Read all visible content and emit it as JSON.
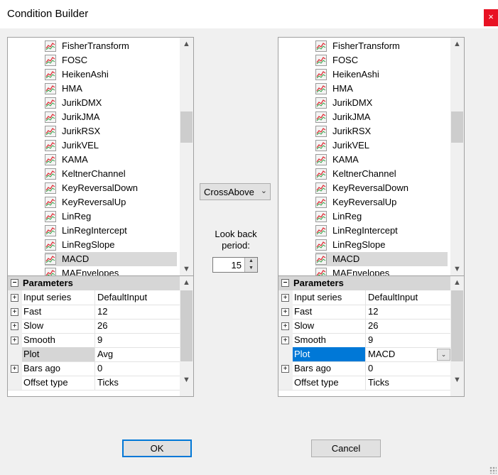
{
  "window": {
    "title": "Condition Builder",
    "close_glyph": "×"
  },
  "indicators": [
    "FisherTransform",
    "FOSC",
    "HeikenAshi",
    "HMA",
    "JurikDMX",
    "JurikJMA",
    "JurikRSX",
    "JurikVEL",
    "KAMA",
    "KeltnerChannel",
    "KeyReversalDown",
    "KeyReversalUp",
    "LinReg",
    "LinRegIntercept",
    "LinRegSlope",
    "MACD",
    "MAEnvelopes"
  ],
  "left_list": {
    "selected": "MACD"
  },
  "right_list": {
    "selected": "MACD"
  },
  "condition": {
    "operator": "CrossAbove",
    "lookback_label": "Look back period:",
    "lookback_value": "15"
  },
  "left_params": {
    "header": "Parameters",
    "rows": [
      {
        "name": "Input series",
        "value": "DefaultInput",
        "expander": true
      },
      {
        "name": "Fast",
        "value": "12",
        "expander": true
      },
      {
        "name": "Slow",
        "value": "26",
        "expander": true
      },
      {
        "name": "Smooth",
        "value": "9",
        "expander": true
      },
      {
        "name": "Plot",
        "value": "Avg",
        "expander": false
      },
      {
        "name": "Bars ago",
        "value": "0",
        "expander": true
      },
      {
        "name": "Offset type",
        "value": "Ticks",
        "expander": false
      }
    ]
  },
  "right_params": {
    "header": "Parameters",
    "rows": [
      {
        "name": "Input series",
        "value": "DefaultInput",
        "expander": true
      },
      {
        "name": "Fast",
        "value": "12",
        "expander": true
      },
      {
        "name": "Slow",
        "value": "26",
        "expander": true
      },
      {
        "name": "Smooth",
        "value": "9",
        "expander": true
      },
      {
        "name": "Plot",
        "value": "MACD",
        "expander": false
      },
      {
        "name": "Bars ago",
        "value": "0",
        "expander": true
      },
      {
        "name": "Offset type",
        "value": "Ticks",
        "expander": false
      }
    ]
  },
  "buttons": {
    "ok": "OK",
    "cancel": "Cancel"
  },
  "icons": {
    "indicator": "indicator-chart-icon",
    "expand": "expand-plus-icon",
    "collapse": "collapse-minus-icon",
    "scroll_up": "scroll-up-arrow-icon",
    "scroll_down": "scroll-down-arrow-icon",
    "dropdown": "chevron-down-icon"
  },
  "colors": {
    "selection_blue": "#0078d7",
    "close_red": "#e81123",
    "icon_red": "#e0303a",
    "icon_green": "#2ea043"
  }
}
